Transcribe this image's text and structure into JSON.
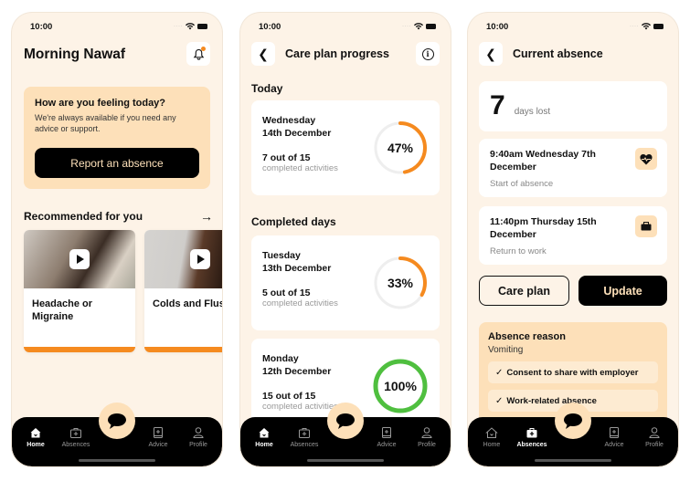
{
  "status_bar": {
    "time": "10:00"
  },
  "home": {
    "greeting": "Morning Nawaf",
    "feeling_card": {
      "title": "How are you feeling today?",
      "text": "We're always available if you need any advice or support.",
      "button": "Report an absence"
    },
    "recommended": {
      "title": "Recommended for you",
      "cards": [
        {
          "title": "Headache or Migraine"
        },
        {
          "title": "Colds and Flus"
        }
      ]
    }
  },
  "care_plan": {
    "title": "Care plan progress",
    "today_label": "Today",
    "completed_label": "Completed days",
    "days": [
      {
        "weekday": "Wednesday",
        "date": "14th December",
        "count": "7 out of 15",
        "sub": "completed activities",
        "percent": 47,
        "percent_label": "47%",
        "color": "#f58a1f"
      },
      {
        "weekday": "Tuesday",
        "date": "13th December",
        "count": "5 out of 15",
        "sub": "completed activities",
        "percent": 33,
        "percent_label": "33%",
        "color": "#f58a1f"
      },
      {
        "weekday": "Monday",
        "date": "12th December",
        "count": "15 out of 15",
        "sub": "completed activities",
        "percent": 100,
        "percent_label": "100%",
        "color": "#4fbf3f"
      }
    ]
  },
  "absence": {
    "title": "Current absence",
    "days_lost": "7",
    "days_lost_label": "days lost",
    "events": [
      {
        "title": "9:40am Wednesday 7th December",
        "sub": "Start of absence",
        "icon": "heart-pulse-icon"
      },
      {
        "title": "11:40pm Thursday 15th December",
        "sub": "Return to work",
        "icon": "briefcase-icon"
      }
    ],
    "care_plan_button": "Care plan",
    "update_button": "Update",
    "reason": {
      "title": "Absence reason",
      "value": "Vomiting",
      "checks": [
        "Consent to share with employer",
        "Work-related absence"
      ]
    }
  },
  "tab_bar": {
    "tabs": [
      {
        "label": "Home",
        "icon": "home-icon"
      },
      {
        "label": "Absences",
        "icon": "medkit-icon"
      },
      {
        "label": "Advice",
        "icon": "book-plus-icon"
      },
      {
        "label": "Profile",
        "icon": "profile-icon"
      }
    ],
    "chat_icon": "chat-bubble-icon"
  },
  "colors": {
    "background": "#fdf3e7",
    "accent_peach": "#fde0b9",
    "accent_orange": "#f58a1f",
    "success_green": "#4fbf3f",
    "dark": "#000000"
  }
}
